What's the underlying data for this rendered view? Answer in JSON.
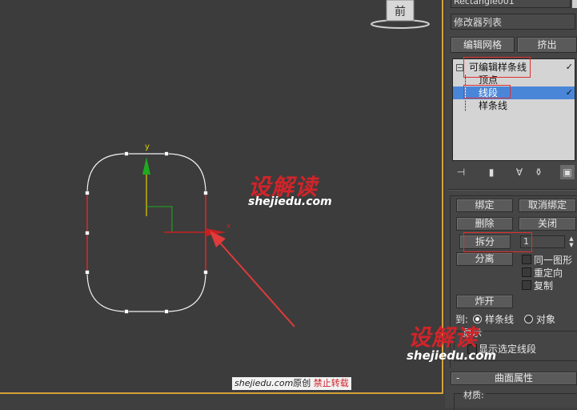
{
  "viewport": {
    "view_cube_label": "前",
    "axis_y": "y",
    "axis_x": "x",
    "watermark_logo": "设解读",
    "watermark_url": "shejiedu.com",
    "footer_site": "shejiedu.com",
    "footer_original": "原创",
    "footer_ban": "禁止转载"
  },
  "panel": {
    "object_name": "Rectangle001",
    "modifier_list": "修改器列表",
    "btn_edit_mesh": "编辑网格",
    "btn_extrude": "挤出",
    "stack": {
      "root": "可编辑样条线",
      "items": [
        "顶点",
        "线段",
        "样条线"
      ]
    },
    "geometry": {
      "bind": "绑定",
      "unbind": "取消绑定",
      "delete": "删除",
      "close": "关闭",
      "divide": "拆分",
      "divide_value": "1",
      "detach": "分离",
      "same_shape": "同一图形",
      "reorient": "重定向",
      "copy": "复制",
      "explode": "炸开",
      "to_label": "到:",
      "to_spline": "样条线",
      "to_object": "对象",
      "display_label": "显示",
      "show_selected_segments": "显示选定线段"
    },
    "surface_title": "曲面属性",
    "surface_minus": "-",
    "material_label": "材质:"
  },
  "colors": {
    "selection_red": "#c82020",
    "highlight_blue": "#4a86d8",
    "watermark_red": "#d0242a",
    "border_gold": "#d4a23a"
  }
}
